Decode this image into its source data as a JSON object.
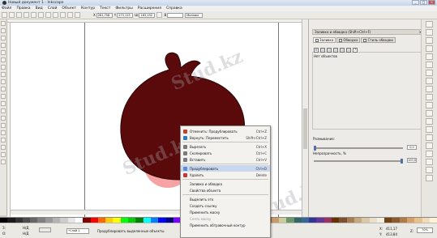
{
  "window": {
    "title": "Новый документ 1 - Inkscape",
    "buttons": [
      "_",
      "□",
      "×"
    ]
  },
  "menubar": [
    "Файл",
    "Правка",
    "Вид",
    "Слой",
    "Объект",
    "Контур",
    "Текст",
    "Фильтры",
    "Расширения",
    "Справка"
  ],
  "command_bar": {
    "x_label": "X",
    "x_value": "261,758",
    "y_label": "Y",
    "y_value": "273,115",
    "w_label": "Ш",
    "w_value": "163,192",
    "h_label": "В",
    "h_value": "",
    "units": "Миллим"
  },
  "fill_stroke": {
    "title": "Заливка и обводка (Shift+Ctrl+F)",
    "tab_fill": "Заливка",
    "tab_stroke": "Обводка",
    "tab_stroke_style": "Стиль обводки",
    "paint_x": "×",
    "paint_unknown": "?",
    "no_objects": "Нет объектов",
    "blur_label": "Размывание:",
    "blur_value": "0,0",
    "opacity_label": "Непрозрачность, %",
    "opacity_value": "100,0",
    "opacity_level": 1.0
  },
  "context_menu": {
    "items": [
      {
        "label": "Отменить: Продублировать",
        "shortcut": "Ctrl+Z",
        "icon_color": "#c2422e"
      },
      {
        "label": "Вернуть: Переместить",
        "shortcut": "Shift+Ctrl+Z",
        "icon_color": "#2e7bc2"
      },
      {
        "label": "Вырезать",
        "shortcut": "Ctrl+X",
        "icon_color": "#7a7a7a"
      },
      {
        "label": "Скопировать",
        "shortcut": "Ctrl+C",
        "icon_color": "#7a7a7a"
      },
      {
        "label": "Вставить",
        "shortcut": "Ctrl+V",
        "icon_color": "#7a7a7a"
      },
      {
        "label": "Продублировать",
        "shortcut": "Ctrl+D",
        "icon_color": "#5b8ed6"
      },
      {
        "label": "Удалить",
        "shortcut": "Delete",
        "icon_color": "#c23a3a"
      },
      {
        "label": "Заливка и обводка",
        "shortcut": "",
        "icon_color": ""
      },
      {
        "label": "Свойства объекта",
        "shortcut": "",
        "icon_color": ""
      },
      {
        "label": "Выделить это",
        "shortcut": "",
        "icon_color": ""
      },
      {
        "label": "Создать ссылку",
        "shortcut": "",
        "icon_color": ""
      },
      {
        "label": "Применить маску",
        "shortcut": "",
        "icon_color": ""
      },
      {
        "label": "Снять маску",
        "shortcut": "",
        "icon_color": ""
      },
      {
        "label": "Применить обтравочный контур",
        "shortcut": "",
        "icon_color": ""
      }
    ],
    "highlighted_index": 5,
    "disabled_index": 12
  },
  "status": {
    "fill_label": "З:",
    "fill_value": "Н/Д",
    "stroke_label": "О:",
    "stroke_value": "Н/Д",
    "layer": "•Слой 1",
    "message": "Продублировать выделенные объекты",
    "x_label": "X:",
    "x_value": "411,17",
    "y_label": "Y:",
    "y_value": "413,84",
    "zoom_label": "Z:",
    "zoom_value": "70%"
  },
  "watermark": "Stud.kz",
  "colors": {
    "shape_fill": "#5a0a0a",
    "shape_shadow": "#f7a3a3",
    "highlight": "#c9d8ef"
  },
  "palette": [
    "#000000",
    "#1a1a1a",
    "#333333",
    "#4d4d4d",
    "#666666",
    "#808080",
    "#999999",
    "#b3b3b3",
    "#cccccc",
    "#e6e6e6",
    "#ffffff",
    "#800000",
    "#ff0000",
    "#ff6600",
    "#ffcc00",
    "#ffff00",
    "#00ff00",
    "#00cc00",
    "#008000",
    "#00ffff",
    "#0080ff",
    "#0000ff",
    "#000080",
    "#8000ff",
    "#ff00ff",
    "#ff0080",
    "#ff9999",
    "#ffcc99",
    "#ffffcc",
    "#ccffcc",
    "#ccffff",
    "#cce5ff",
    "#ccccff",
    "#ffccff",
    "#993300",
    "#996633",
    "#cc9966",
    "#cccc99",
    "#669966",
    "#336666",
    "#336699",
    "#333399",
    "#663399",
    "#993366",
    "#663300",
    "#7a5230",
    "#a67c52",
    "#c8a97e",
    "#d8c8a8",
    "#eadfc8",
    "#f5efe2",
    "#704214",
    "#8c5a2b",
    "#b37a45",
    "#d9a066",
    "#e8c08a",
    "#f2dcb5",
    "#fff2d6"
  ]
}
